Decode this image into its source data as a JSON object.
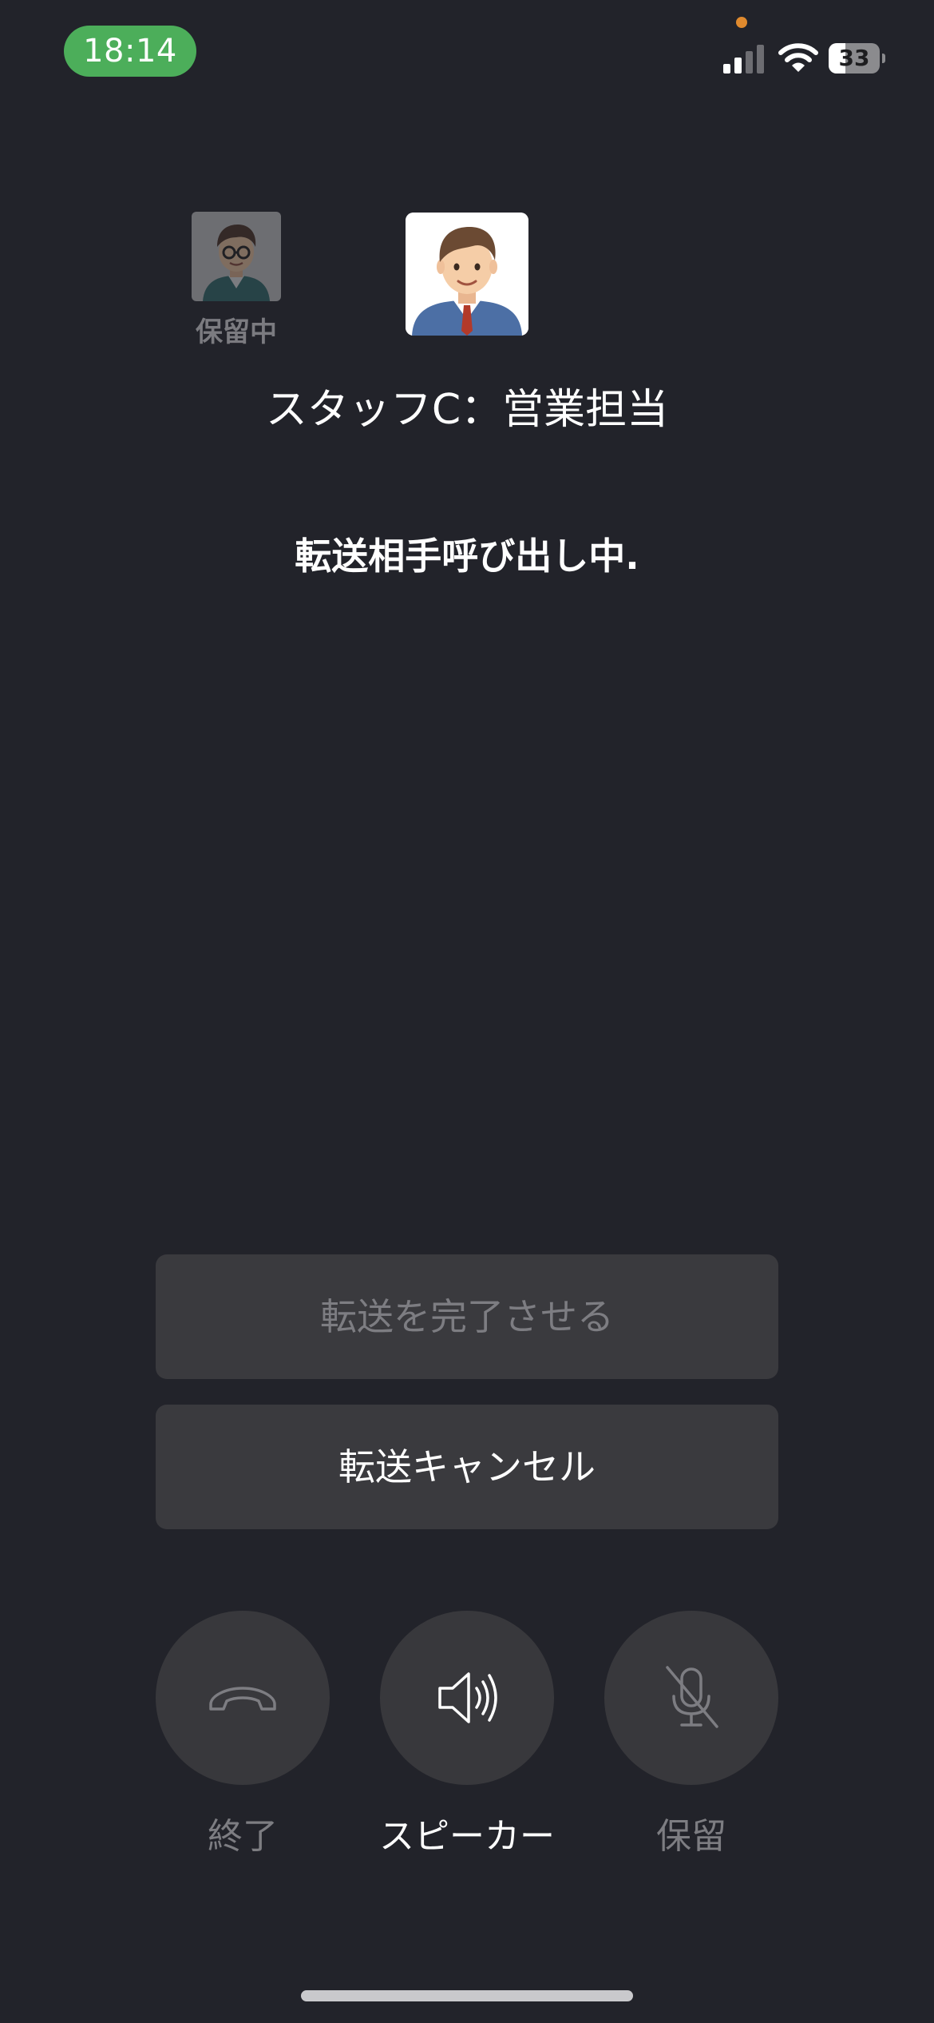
{
  "status_bar": {
    "time": "18:14",
    "battery_level": "33",
    "battery_fraction": 0.33,
    "signal_bars_active": 2,
    "signal_bars_total": 4,
    "time_pill_color": "#4cae5a",
    "mic_indicator_color": "#e08a2e",
    "icons": [
      "signal-icon",
      "wifi-icon",
      "battery-icon"
    ]
  },
  "call": {
    "held_label": "保留中",
    "caller_name": "スタッフC：営業担当",
    "status": "転送相手呼び出し中."
  },
  "actions": {
    "complete_transfer": "転送を完了させる",
    "cancel_transfer": "転送キャンセル"
  },
  "controls": {
    "end": {
      "label": "終了",
      "icon": "phone-hangup-icon",
      "enabled": false
    },
    "speaker": {
      "label": "スピーカー",
      "icon": "speaker-icon",
      "enabled": true
    },
    "hold": {
      "label": "保留",
      "icon": "mic-muted-icon",
      "enabled": false
    }
  }
}
